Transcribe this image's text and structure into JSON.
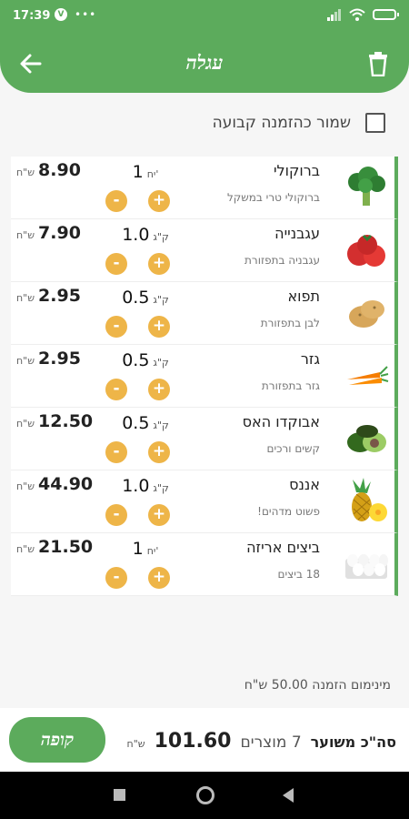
{
  "status": {
    "time": "17:39",
    "v_badge": "V",
    "dots": "•••",
    "battery": "88"
  },
  "header": {
    "title": "עגלה"
  },
  "standing_order_label": "שמור כהזמנה קבועה",
  "items": [
    {
      "name": "ברוקולי",
      "desc": "ברוקולי טרי במשקל",
      "qty": "1",
      "unit": "יח'",
      "price": "8.90",
      "currency": "ש\"ח",
      "icon": "broccoli-icon"
    },
    {
      "name": "עגבנייה",
      "desc": "עגבניה בתפזורת",
      "qty": "1.0",
      "unit": "ק\"ג",
      "price": "7.90",
      "currency": "ש\"ח",
      "icon": "tomato-icon"
    },
    {
      "name": "תפוא",
      "desc": "לבן בתפזורת",
      "qty": "0.5",
      "unit": "ק\"ג",
      "price": "2.95",
      "currency": "ש\"ח",
      "icon": "potato-icon"
    },
    {
      "name": "גזר",
      "desc": "גזר בתפזורת",
      "qty": "0.5",
      "unit": "ק\"ג",
      "price": "2.95",
      "currency": "ש\"ח",
      "icon": "carrot-icon"
    },
    {
      "name": "אבוקדו האס",
      "desc": "קשים ורכים",
      "qty": "0.5",
      "unit": "ק\"ג",
      "price": "12.50",
      "currency": "ש\"ח",
      "icon": "avocado-icon"
    },
    {
      "name": "אננס",
      "desc": "פשוט מדהים!",
      "qty": "1.0",
      "unit": "ק\"ג",
      "price": "44.90",
      "currency": "ש\"ח",
      "icon": "pineapple-icon"
    },
    {
      "name": "ביצים אריזה",
      "desc": "18 ביצים",
      "qty": "1",
      "unit": "יח'",
      "price": "21.50",
      "currency": "ש\"ח",
      "icon": "eggs-icon"
    }
  ],
  "plus_label": "+",
  "minus_label": "-",
  "min_order": "מינימום הזמנה 50.00 ש\"ח",
  "footer": {
    "total_label": "סה\"כ משוער",
    "count": "7 מוצרים",
    "amount": "101.60",
    "currency": "ש\"ח",
    "checkout": "קופה"
  },
  "colors": {
    "primary": "#5cab5c",
    "accent": "#eeb548"
  }
}
